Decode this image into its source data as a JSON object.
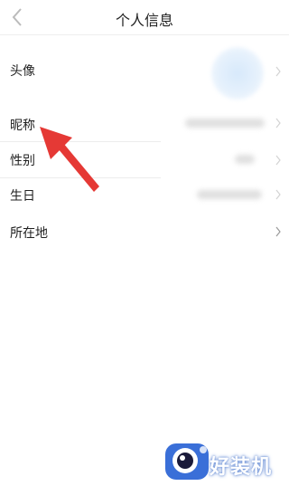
{
  "header": {
    "title": "个人信息",
    "back_icon": "chevron-left-icon"
  },
  "rows": [
    {
      "label": "头像",
      "value": "",
      "chevron": true
    },
    {
      "label": "昵称",
      "value": "",
      "chevron": true
    },
    {
      "label": "性别",
      "value": "",
      "chevron": true
    },
    {
      "label": "生日",
      "value": "",
      "chevron": true
    },
    {
      "label": "所在地",
      "value": "",
      "chevron": true
    }
  ],
  "annotation": {
    "arrow_color": "#e53935"
  },
  "watermark": {
    "text": "好装机",
    "color": "#3a6fd8"
  },
  "colors": {
    "divider": "#ececec",
    "chevron": "#c8c8c8"
  }
}
